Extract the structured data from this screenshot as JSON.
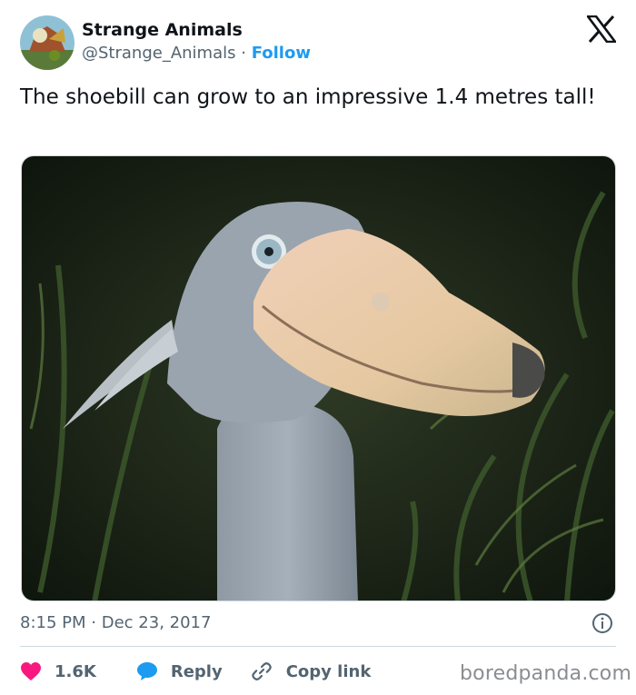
{
  "author": {
    "display_name": "Strange Animals",
    "handle": "@Strange_Animals",
    "separator": "·",
    "follow_label": "Follow"
  },
  "platform_icon": "x-logo-icon",
  "tweet": {
    "text": "The shoebill can grow to an impressive 1.4 metres tall!",
    "image_icon": "shoebill-photo",
    "time": "8:15 PM",
    "date_separator": "·",
    "date": "Dec 23, 2017"
  },
  "actions": {
    "likes": "1.6K",
    "reply_label": "Reply",
    "copy_link_label": "Copy link"
  },
  "watermark": "boredpanda.com",
  "colors": {
    "accent": "#1d9bf0",
    "heart": "#f91880",
    "secondary_text": "#536471",
    "primary_text": "#0f1419",
    "divider": "#cfd9de"
  }
}
